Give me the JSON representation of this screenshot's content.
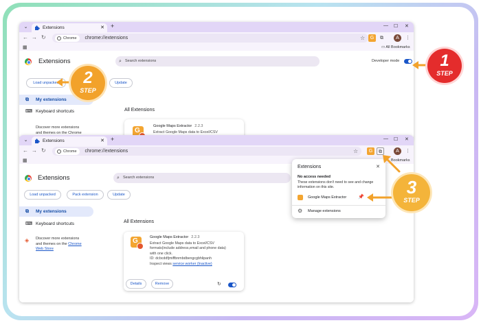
{
  "colors": {
    "accent": "#1a56c8",
    "step1": "#e42c2c",
    "step2": "#f2a22b",
    "step3": "#f4b43a",
    "toolbar": "#e2d6f7"
  },
  "top_window": {
    "tab_title": "Extensions",
    "url_chip": "Chrome",
    "url": "chrome://extensions",
    "bookmarks": "All Bookmarks",
    "page_title": "Extensions",
    "search_placeholder": "Search extensions",
    "developer_mode_label": "Developer mode",
    "load_unpacked": "Load unpacked",
    "update": "Update",
    "sidebar": {
      "my_extensions": "My extensions",
      "keyboard_shortcuts": "Keyboard shortcuts",
      "discover_line1": "Discover more extensions",
      "discover_line2": "and themes on the Chrome"
    },
    "all_extensions": "All Extensions",
    "ext_name": "Google Maps Extractor",
    "ext_version": "2.2.3",
    "ext_desc": "Extract Google Maps data to Excel/CSV"
  },
  "bottom_window": {
    "tab_title": "Extensions",
    "url_chip": "Chrome",
    "url": "chrome://extensions",
    "bookmarks_partial": "Bookmarks",
    "page_title": "Extensions",
    "search_placeholder": "Search extensions",
    "load_unpacked": "Load unpacked",
    "pack_extension": "Pack extension",
    "update": "Update",
    "sidebar": {
      "my_extensions": "My extensions",
      "keyboard_shortcuts": "Keyboard shortcuts",
      "discover_line1": "Discover more extensions",
      "discover_line2": "and themes on the",
      "discover_chrome": "Chrome",
      "discover_store": "Web Store"
    },
    "all_extensions": "All Extensions",
    "card": {
      "name": "Google Maps Extractor",
      "version": "2.2.3",
      "desc_line1": "Extract Google Maps data to Excel/CSV",
      "desc_line2": "formats(include address,email and phone data)",
      "desc_line3": "with one click.",
      "id_line": "ID: dcbcddfjmiffbnmbdbengcgbhlipanh",
      "inspect_prefix": "Inspect views",
      "inspect_link": "service worker (Inactive)",
      "details": "Details",
      "remove": "Remove"
    }
  },
  "popup": {
    "title": "Extensions",
    "no_access": "No access needed",
    "no_access_desc": "These extensions don't need to see and change information on this site.",
    "item": "Google Maps Extractor",
    "manage": "Manage extensions"
  },
  "steps": {
    "s1": {
      "num": "1",
      "label": "STEP"
    },
    "s2": {
      "num": "2",
      "label": "STEP"
    },
    "s3": {
      "num": "3",
      "label": "STEP"
    }
  }
}
